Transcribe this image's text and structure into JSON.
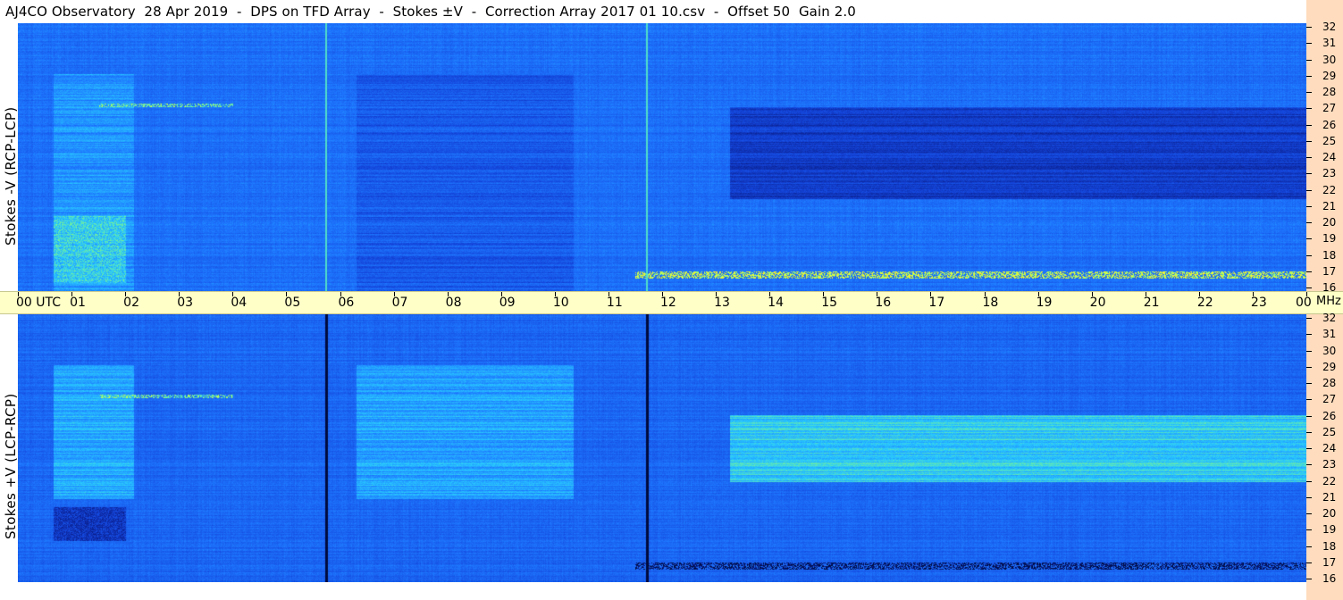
{
  "title": "AJ4CO Observatory  28 Apr 2019  -  DPS on TFD Array  -  Stokes ±V  -  Correction Array 2017 01 10.csv  -  Offset 50  Gain 2.0",
  "panels": {
    "top": {
      "ylabel": "Stokes -V (RCP-LCP)"
    },
    "bottom": {
      "ylabel": "Stokes +V (LCP-RCP)"
    }
  },
  "time_axis": {
    "labels": [
      "00 UTC",
      "01",
      "02",
      "03",
      "04",
      "05",
      "06",
      "07",
      "08",
      "09",
      "10",
      "11",
      "12",
      "13",
      "14",
      "15",
      "16",
      "17",
      "18",
      "19",
      "20",
      "21",
      "22",
      "23",
      "00"
    ],
    "unit": "MHz"
  },
  "freq_ticks": [
    "32",
    "31",
    "30",
    "29",
    "28",
    "27",
    "26",
    "25",
    "24",
    "23",
    "22",
    "21",
    "20",
    "19",
    "18",
    "17",
    "16"
  ],
  "colors": {
    "background": "#ffffff",
    "time_axis_bg": "#ffffc8",
    "right_strip": "#ffdcbd",
    "colormap": [
      "#000a3c",
      "#0a1e8c",
      "#1446dc",
      "#1e78ff",
      "#28c8ff",
      "#8cff78",
      "#ffff28",
      "#ffa000",
      "#ff3c00"
    ]
  },
  "chart_data": {
    "type": "heatmap",
    "title": "AJ4CO Observatory  28 Apr 2019  -  DPS on TFD Array  -  Stokes ±V  -  Correction Array 2017 01 10.csv  -  Offset 50  Gain 2.0",
    "x_axis": {
      "unit": "UTC hour",
      "range": [
        0,
        24
      ],
      "ticks": [
        0,
        1,
        2,
        3,
        4,
        5,
        6,
        7,
        8,
        9,
        10,
        11,
        12,
        13,
        14,
        15,
        16,
        17,
        18,
        19,
        20,
        21,
        22,
        23,
        24
      ]
    },
    "y_axis": {
      "unit": "MHz",
      "range": [
        16,
        32
      ],
      "ticks": [
        16,
        17,
        18,
        19,
        20,
        21,
        22,
        23,
        24,
        25,
        26,
        27,
        28,
        29,
        30,
        31,
        32
      ]
    },
    "panels": [
      {
        "name": "Stokes -V (RCP-LCP)",
        "background_level": 0.35,
        "features": [
          {
            "kind": "dark-block",
            "hours": [
              0.65,
              0.95
            ],
            "mhz": [
              21.0,
              29.0
            ],
            "level": 0.05
          },
          {
            "kind": "dark-block",
            "hours": [
              6.3,
              6.8
            ],
            "mhz": [
              21.0,
              29.0
            ],
            "level": 0.05
          },
          {
            "kind": "band",
            "hours": [
              0.65,
              2.15
            ],
            "mhz": [
              16.0,
              29.0
            ],
            "level": 0.42
          },
          {
            "kind": "band",
            "hours": [
              6.3,
              10.35
            ],
            "mhz": [
              16.0,
              29.0
            ],
            "level": 0.3
          },
          {
            "kind": "band",
            "hours": [
              13.25,
              24.0
            ],
            "mhz": [
              21.5,
              27.0
            ],
            "level": 0.22
          },
          {
            "kind": "bright-patch",
            "hours": [
              0.65,
              2.0
            ],
            "mhz": [
              16.5,
              20.5
            ],
            "level": 0.6
          },
          {
            "kind": "interference",
            "hours": [
              11.5,
              24.0
            ],
            "mhz": [
              16.8,
              17.2
            ],
            "level": 0.7
          },
          {
            "kind": "interference",
            "hours": [
              1.5,
              4.0
            ],
            "mhz": [
              27.0,
              27.2
            ],
            "level": 0.6
          },
          {
            "kind": "vertical-line",
            "hour": 5.72,
            "level": 0.55
          },
          {
            "kind": "vertical-line",
            "hour": 11.7,
            "level": 0.55
          }
        ]
      },
      {
        "name": "Stokes +V (LCP-RCP)",
        "background_level": 0.33,
        "features": [
          {
            "kind": "bright-block",
            "hours": [
              0.65,
              0.95
            ],
            "mhz": [
              22.0,
              26.3
            ],
            "level": 0.78
          },
          {
            "kind": "bright-block",
            "hours": [
              6.3,
              6.8
            ],
            "mhz": [
              22.0,
              26.3
            ],
            "level": 0.78
          },
          {
            "kind": "band",
            "hours": [
              0.65,
              2.15
            ],
            "mhz": [
              21.0,
              29.0
            ],
            "level": 0.45
          },
          {
            "kind": "band",
            "hours": [
              6.3,
              10.35
            ],
            "mhz": [
              21.0,
              29.0
            ],
            "level": 0.44
          },
          {
            "kind": "band",
            "hours": [
              13.25,
              24.0
            ],
            "mhz": [
              22.0,
              26.0
            ],
            "level": 0.5
          },
          {
            "kind": "dark-patch",
            "hours": [
              0.65,
              2.0
            ],
            "mhz": [
              18.5,
              20.5
            ],
            "level": 0.08
          },
          {
            "kind": "interference",
            "hours": [
              11.5,
              24.0
            ],
            "mhz": [
              16.8,
              17.2
            ],
            "level": 0.05
          },
          {
            "kind": "interference",
            "hours": [
              1.5,
              4.0
            ],
            "mhz": [
              27.0,
              27.2
            ],
            "level": 0.6
          },
          {
            "kind": "vertical-line",
            "hour": 5.72,
            "level": 0.0
          },
          {
            "kind": "vertical-line",
            "hour": 11.7,
            "level": 0.0
          }
        ]
      }
    ]
  }
}
